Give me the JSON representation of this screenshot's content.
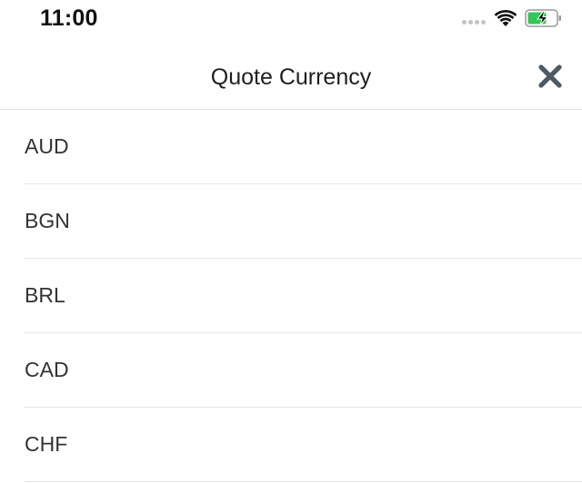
{
  "status_bar": {
    "time": "11:00",
    "icons": [
      "cellular-signal-icon",
      "wifi-icon",
      "battery-charging-icon"
    ],
    "battery_color": "#34c759"
  },
  "header": {
    "title": "Quote Currency",
    "close_icon": "close-icon",
    "close_color": "#4e5a63"
  },
  "currencies": [
    {
      "code": "AUD"
    },
    {
      "code": "BGN"
    },
    {
      "code": "BRL"
    },
    {
      "code": "CAD"
    },
    {
      "code": "CHF"
    }
  ]
}
